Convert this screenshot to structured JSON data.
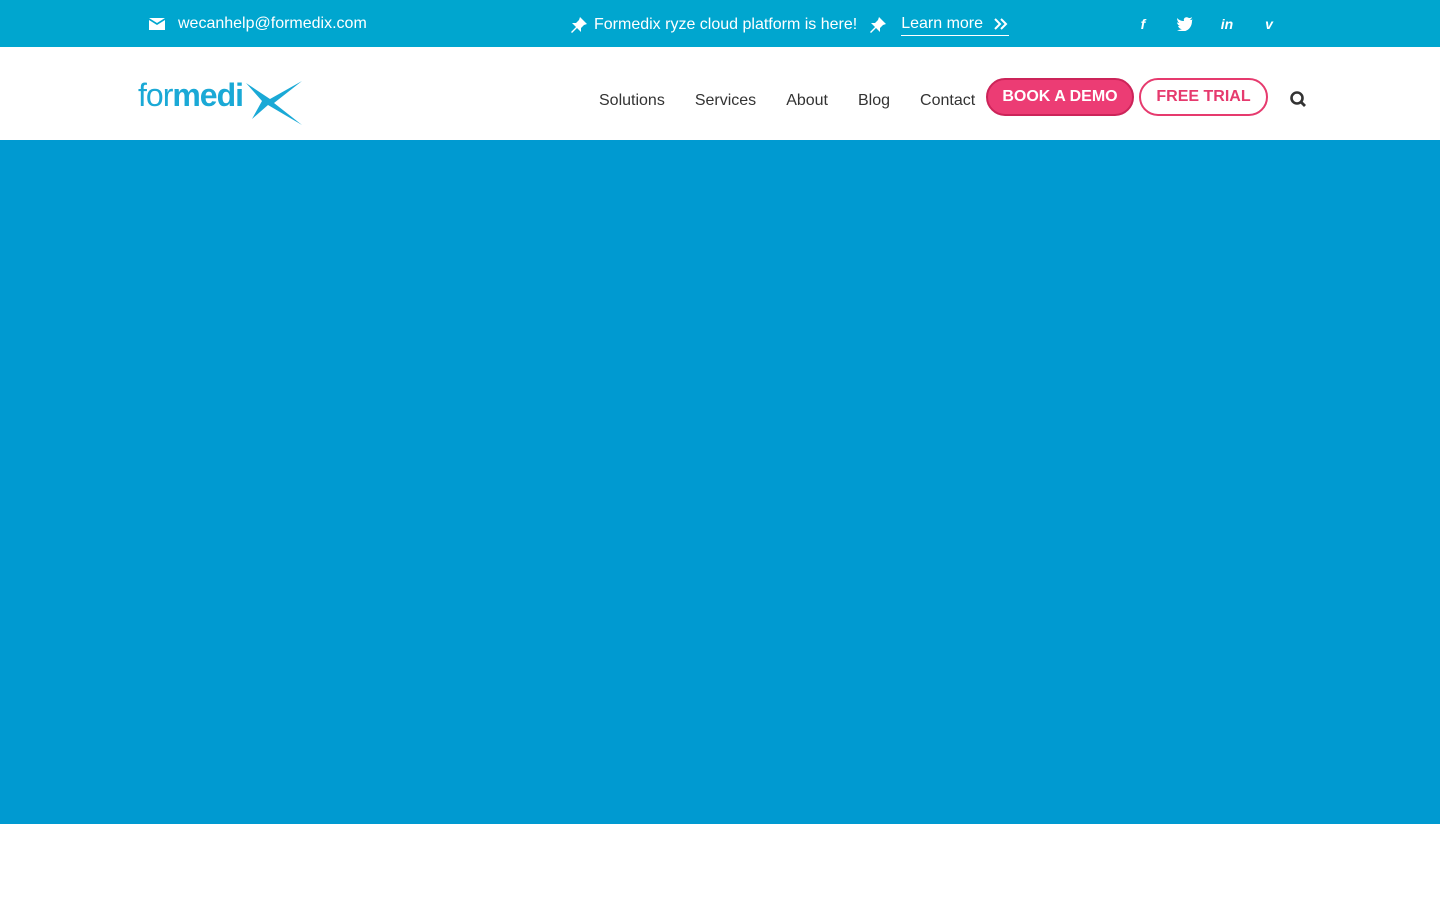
{
  "topbar": {
    "email": "wecanhelp@formedix.com",
    "promo_text": "Formedix ryze cloud platform is here!",
    "learn_more": "Learn more",
    "social": [
      {
        "name": "facebook",
        "glyph": "f"
      },
      {
        "name": "twitter",
        "glyph": ""
      },
      {
        "name": "linkedin",
        "glyph": "in"
      },
      {
        "name": "vimeo",
        "glyph": "v"
      }
    ]
  },
  "header": {
    "logo_part1": "for",
    "logo_part2": "medi",
    "nav": [
      "Solutions",
      "Services",
      "About",
      "Blog",
      "Contact"
    ],
    "book_demo": "BOOK A DEMO",
    "free_trial": "FREE TRIAL"
  },
  "colors": {
    "topbar_bg": "#00a6cf",
    "hero_bg": "#009ad1",
    "accent_pink": "#ec3c74",
    "logo_blue": "#1aa9d6"
  },
  "icons": [
    "envelope-icon",
    "pin-icon",
    "double-chevron-right-icon",
    "facebook-icon",
    "twitter-icon",
    "linkedin-icon",
    "vimeo-icon",
    "search-icon"
  ]
}
